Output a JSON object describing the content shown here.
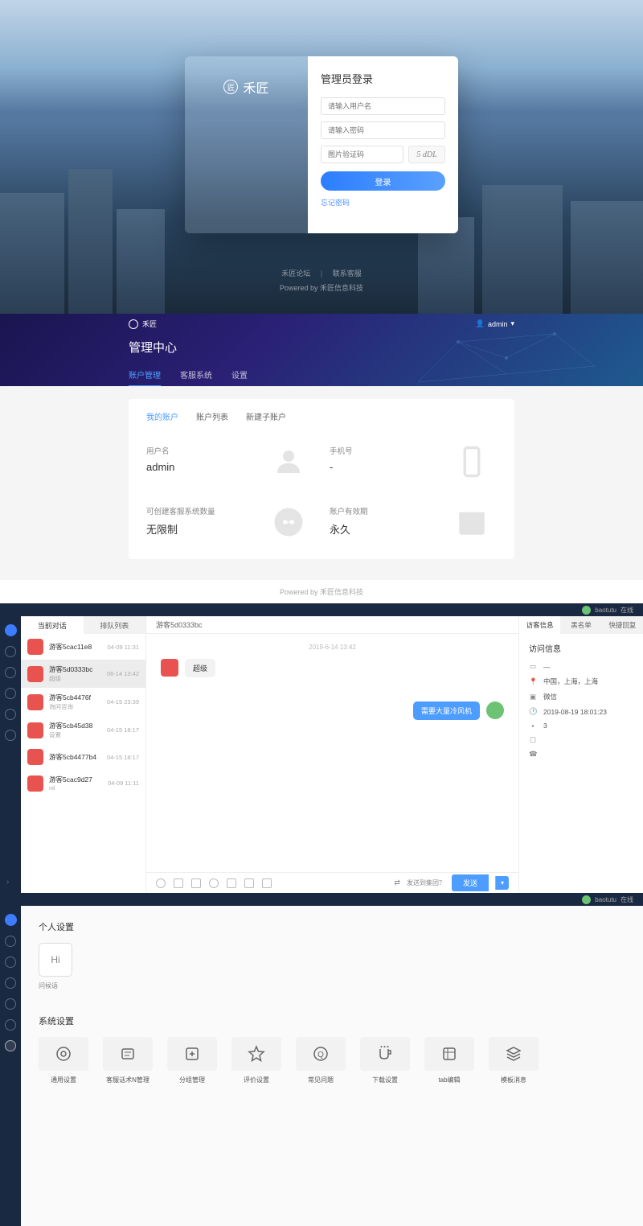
{
  "login": {
    "brand": "禾匠",
    "title": "管理员登录",
    "username_ph": "请输入用户名",
    "password_ph": "请输入密码",
    "captcha_ph": "图片验证码",
    "captcha_text": "5 dDL",
    "submit": "登录",
    "forgot": "忘记密码",
    "footer_links": [
      "禾匠论坛",
      "联系客服"
    ],
    "footer_powered": "Powered by 禾匠信息科技"
  },
  "mgmt": {
    "brand": "禾匠",
    "user": "admin",
    "title": "管理中心",
    "tabs": [
      "账户管理",
      "客服系统",
      "设置"
    ],
    "subtabs": [
      "我的账户",
      "账户列表",
      "新建子账户"
    ],
    "fields": {
      "username_label": "用户名",
      "username_value": "admin",
      "phone_label": "手机号",
      "phone_value": "-",
      "systems_label": "可创建客服系统数量",
      "systems_value": "无限制",
      "expire_label": "账户有效期",
      "expire_value": "永久"
    },
    "footer": "Powered by 禾匠信息科技"
  },
  "chat": {
    "username": "baotutu",
    "status": "在线",
    "list_tabs": [
      "当前对话",
      "排队列表"
    ],
    "items": [
      {
        "name": "游客5cac11e8",
        "sub": "",
        "time": "04-09 11:31"
      },
      {
        "name": "游客5d0333bc",
        "sub": "超级",
        "time": "06-14 13:42"
      },
      {
        "name": "游客5cb4476f",
        "sub": "询问咨询",
        "time": "04-15 23:39"
      },
      {
        "name": "游客5cb45d38",
        "sub": "设置",
        "time": "04-15 18:17"
      },
      {
        "name": "游客5cb4477b4",
        "sub": "",
        "time": "04-15 18:17"
      },
      {
        "name": "游客5cac9d27",
        "sub": "nil",
        "time": "04-09 11:11"
      }
    ],
    "chat_header": "游客5d0333bc",
    "chat_time": "2019-6-14 13:42",
    "msg_left": "超级",
    "msg_right": "需要大量冷风机",
    "transfer": "发送到集团？",
    "send": "发送",
    "info_tabs": [
      "访客信息",
      "黑名单",
      "快捷回复"
    ],
    "info_title": "访问信息",
    "info_rows": {
      "location": "中国，上海，上海",
      "device": "微信",
      "time": "2019-08-19 18:01:23",
      "count": "3"
    }
  },
  "settings": {
    "username": "baotutu",
    "status": "在线",
    "personal_title": "个人设置",
    "avatar_text": "Hi",
    "avatar_label": "问候语",
    "system_title": "系统设置",
    "cards": [
      "通用设置",
      "客服话术N管理",
      "分组管理",
      "评价设置",
      "常见问题",
      "下载设置",
      "tab编辑",
      "模板消息"
    ]
  }
}
